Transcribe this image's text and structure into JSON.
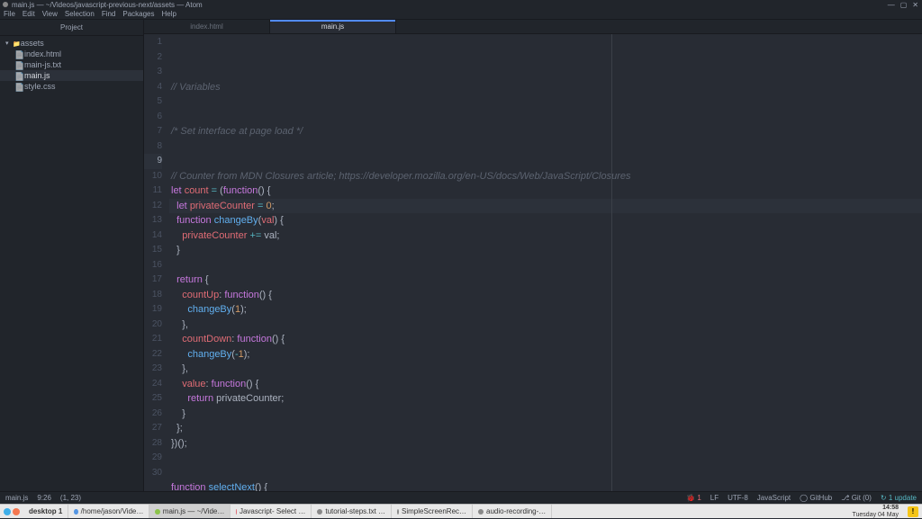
{
  "window": {
    "title": "main.js — ~/Videos/javascript-previous-next/assets — Atom"
  },
  "menu": [
    "File",
    "Edit",
    "View",
    "Selection",
    "Find",
    "Packages",
    "Help"
  ],
  "sidebar": {
    "header": "Project",
    "root": "assets",
    "files": [
      "index.html",
      "main-js.txt",
      "main.js",
      "style.css"
    ],
    "selected": 2
  },
  "tabs": [
    {
      "label": "index.html",
      "active": false
    },
    {
      "label": "main.js",
      "active": true
    }
  ],
  "code": {
    "current_line": 9,
    "lines": [
      [
        [
          "cm",
          "// Variables"
        ]
      ],
      [],
      [],
      [
        [
          "cm",
          "/* Set interface at page load */"
        ]
      ],
      [],
      [],
      [
        [
          "cm",
          "// Counter from MDN Closures article; https://developer.mozilla.org/en-US/docs/Web/JavaScript/Closures"
        ]
      ],
      [
        [
          "kw",
          "let"
        ],
        [
          "pl",
          " "
        ],
        [
          "var",
          "count"
        ],
        [
          "pl",
          " "
        ],
        [
          "op",
          "="
        ],
        [
          "pl",
          " ("
        ],
        [
          "kw",
          "function"
        ],
        [
          "pl",
          "() {"
        ]
      ],
      [
        [
          "pl",
          "  "
        ],
        [
          "kw",
          "let"
        ],
        [
          "pl",
          " "
        ],
        [
          "var",
          "privateCounter"
        ],
        [
          "pl",
          " "
        ],
        [
          "op",
          "="
        ],
        [
          "pl",
          " "
        ],
        [
          "num",
          "0"
        ],
        [
          "pl",
          ";"
        ]
      ],
      [
        [
          "pl",
          "  "
        ],
        [
          "kw",
          "function"
        ],
        [
          "pl",
          " "
        ],
        [
          "fn",
          "changeBy"
        ],
        [
          "pl",
          "("
        ],
        [
          "var",
          "val"
        ],
        [
          "pl",
          ") {"
        ]
      ],
      [
        [
          "pl",
          "    "
        ],
        [
          "var",
          "privateCounter"
        ],
        [
          "pl",
          " "
        ],
        [
          "op",
          "+="
        ],
        [
          "pl",
          " val;"
        ]
      ],
      [
        [
          "pl",
          "  }"
        ]
      ],
      [],
      [
        [
          "pl",
          "  "
        ],
        [
          "kw",
          "return"
        ],
        [
          "pl",
          " {"
        ]
      ],
      [
        [
          "pl",
          "    "
        ],
        [
          "var",
          "countUp"
        ],
        [
          "pl",
          ": "
        ],
        [
          "kw",
          "function"
        ],
        [
          "pl",
          "() {"
        ]
      ],
      [
        [
          "pl",
          "      "
        ],
        [
          "fn",
          "changeBy"
        ],
        [
          "pl",
          "("
        ],
        [
          "num",
          "1"
        ],
        [
          "pl",
          ");"
        ]
      ],
      [
        [
          "pl",
          "    },"
        ]
      ],
      [
        [
          "pl",
          "    "
        ],
        [
          "var",
          "countDown"
        ],
        [
          "pl",
          ": "
        ],
        [
          "kw",
          "function"
        ],
        [
          "pl",
          "() {"
        ]
      ],
      [
        [
          "pl",
          "      "
        ],
        [
          "fn",
          "changeBy"
        ],
        [
          "pl",
          "("
        ],
        [
          "op",
          "-"
        ],
        [
          "num",
          "1"
        ],
        [
          "pl",
          ");"
        ]
      ],
      [
        [
          "pl",
          "    },"
        ]
      ],
      [
        [
          "pl",
          "    "
        ],
        [
          "var",
          "value"
        ],
        [
          "pl",
          ": "
        ],
        [
          "kw",
          "function"
        ],
        [
          "pl",
          "() {"
        ]
      ],
      [
        [
          "pl",
          "      "
        ],
        [
          "kw",
          "return"
        ],
        [
          "pl",
          " privateCounter;"
        ]
      ],
      [
        [
          "pl",
          "    }"
        ]
      ],
      [
        [
          "pl",
          "  };"
        ]
      ],
      [
        [
          "pl",
          "})();"
        ]
      ],
      [],
      [],
      [
        [
          "kw",
          "function"
        ],
        [
          "pl",
          " "
        ],
        [
          "fn",
          "selectNext"
        ],
        [
          "pl",
          "() {"
        ]
      ],
      [],
      [
        [
          "pl",
          "}"
        ]
      ]
    ]
  },
  "status": {
    "file": "main.js",
    "cursor": "9:26",
    "sel": "(1, 23)",
    "err": "1",
    "line_ending": "LF",
    "encoding": "UTF-8",
    "grammar": "JavaScript",
    "github": "GitHub",
    "git": "Git (0)",
    "updates": "1 update"
  },
  "taskbar": {
    "desktop": "desktop 1",
    "items": [
      "/home/jason/Vide…",
      "main.js — ~/Vide…",
      "Javascript- Select …",
      "tutorial-steps.txt …",
      "SimpleScreenRec…",
      "audio-recording-…"
    ],
    "active": 1,
    "time": "14:58",
    "date": "Tuesday 04 May"
  }
}
